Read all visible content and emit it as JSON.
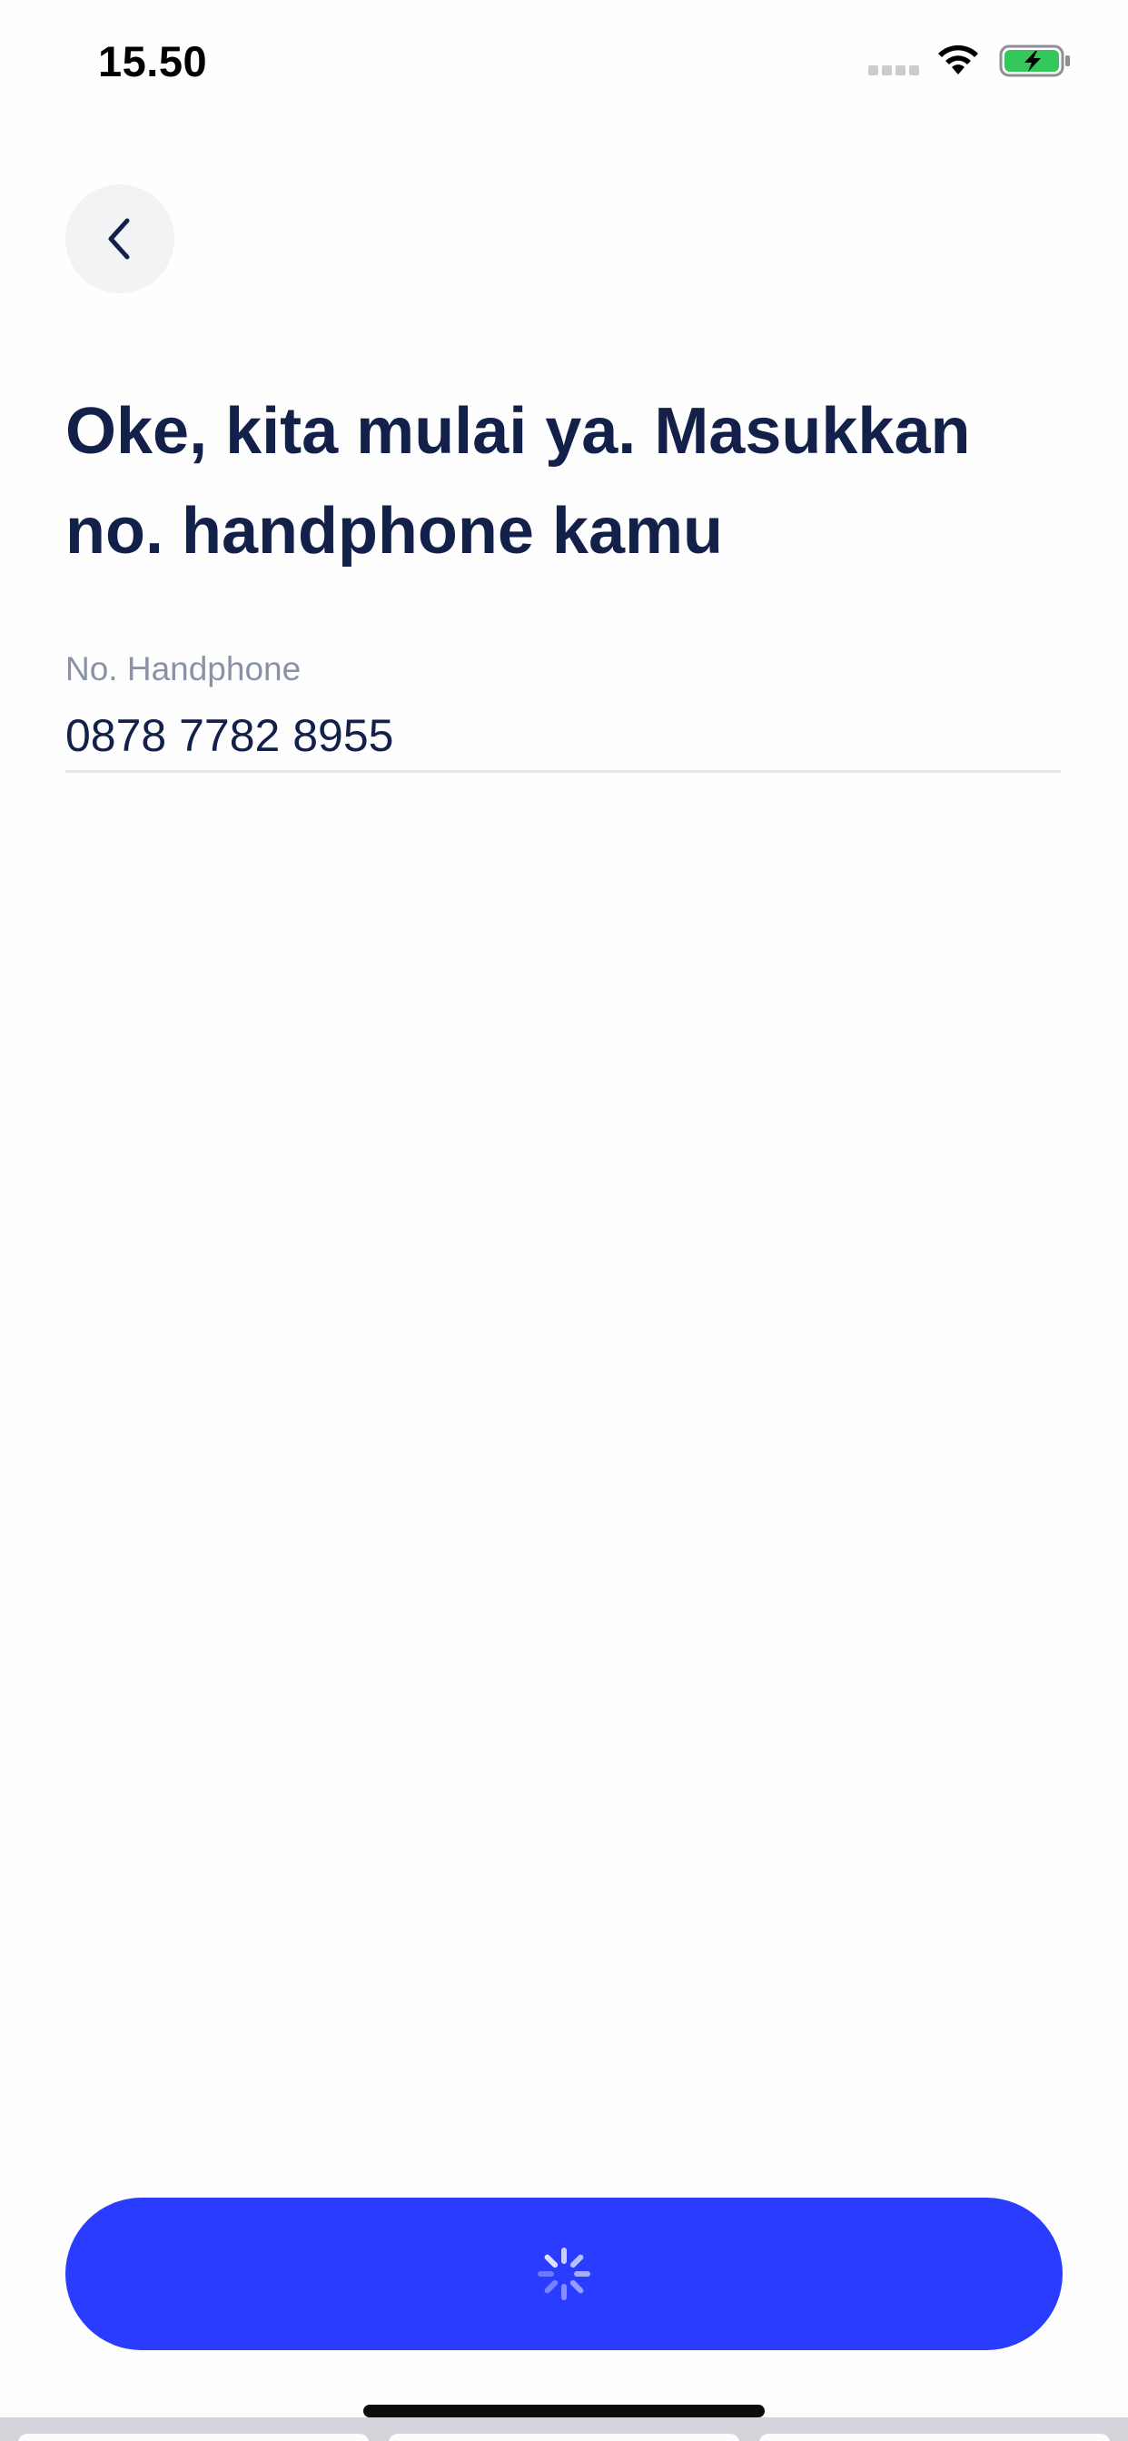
{
  "status_bar": {
    "time": "15.50",
    "icons": [
      "cellular-signal-icon",
      "wifi-icon",
      "battery-charging-icon"
    ]
  },
  "header": {
    "back_icon": "chevron-left-icon"
  },
  "title": "Oke, kita mulai ya. Masukkan no. handphone kamu",
  "phone_field": {
    "label": "No. Handphone",
    "value": "0878 7782 8955"
  },
  "primary_button": {
    "state_icon": "loading-spinner-icon"
  },
  "colors": {
    "primary": "#2a3cff",
    "title": "#13204a",
    "label": "#8a93a6",
    "battery": "#34c759"
  }
}
